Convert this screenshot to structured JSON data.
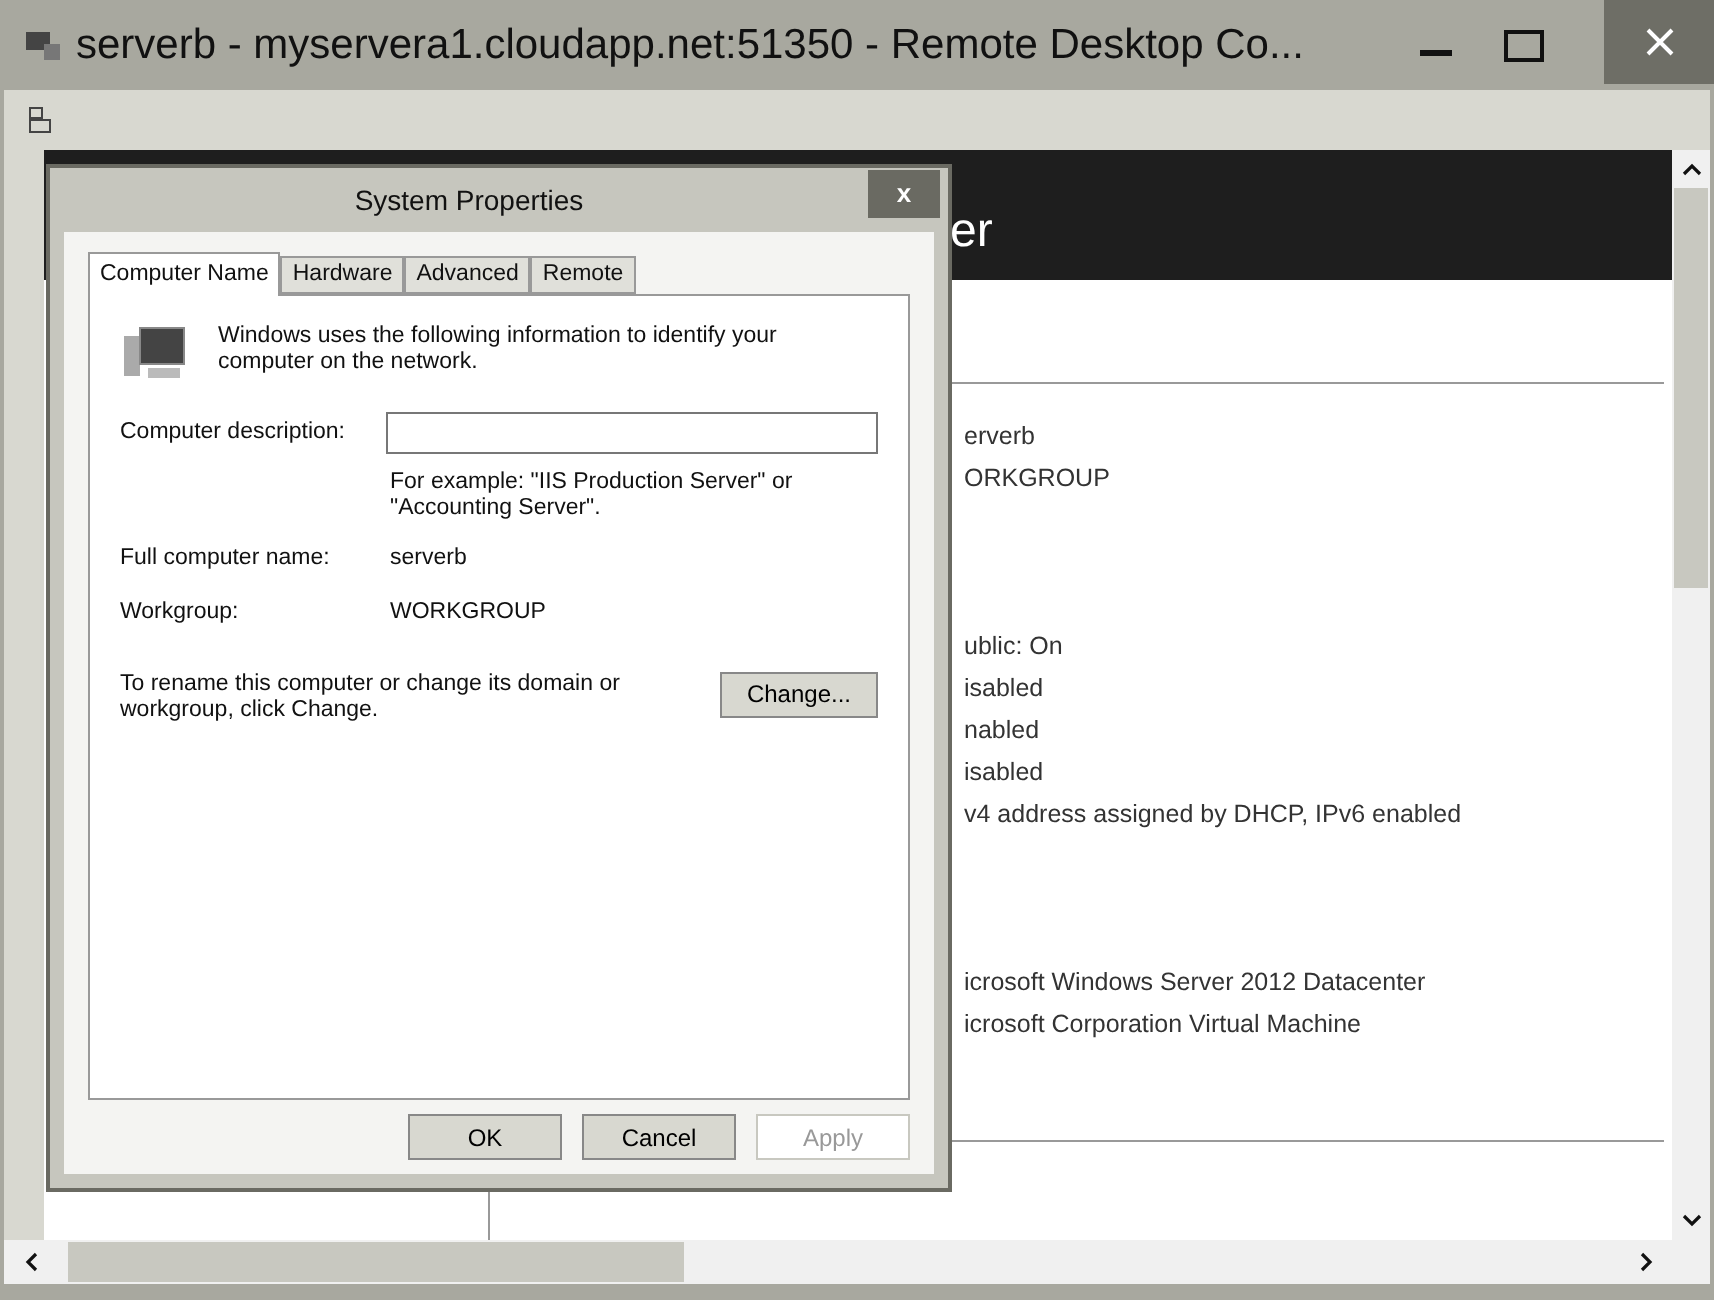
{
  "window": {
    "title": "serverb - myservera1.cloudapp.net:51350 - Remote Desktop Co..."
  },
  "background_app": {
    "header": "er",
    "rows": [
      "erverb",
      "ORKGROUP",
      null,
      null,
      null,
      "ublic: On",
      "isabled",
      "nabled",
      "isabled",
      "v4 address assigned by DHCP, IPv6 enabled",
      null,
      null,
      null,
      "icrosoft Windows Server 2012 Datacenter",
      "icrosoft Corporation Virtual Machine"
    ]
  },
  "dialog": {
    "title": "System Properties",
    "close": "x",
    "tabs": [
      {
        "label": "Computer Name",
        "selected": true
      },
      {
        "label": "Hardware",
        "selected": false
      },
      {
        "label": "Advanced",
        "selected": false
      },
      {
        "label": "Remote",
        "selected": false
      }
    ],
    "intro": "Windows uses the following information to identify your computer on the network.",
    "description_label": "Computer description:",
    "example": "For example: \"IIS Production Server\" or \"Accounting Server\".",
    "fields": [
      {
        "label": "Full computer name:",
        "value": "serverb"
      },
      {
        "label": "Workgroup:",
        "value": "WORKGROUP"
      }
    ],
    "rename_text": "To rename this computer or change its domain or workgroup, click Change.",
    "change_button": "Change...",
    "buttons": [
      {
        "label": "OK",
        "disabled": false
      },
      {
        "label": "Cancel",
        "disabled": false
      },
      {
        "label": "Apply",
        "disabled": true
      }
    ]
  }
}
